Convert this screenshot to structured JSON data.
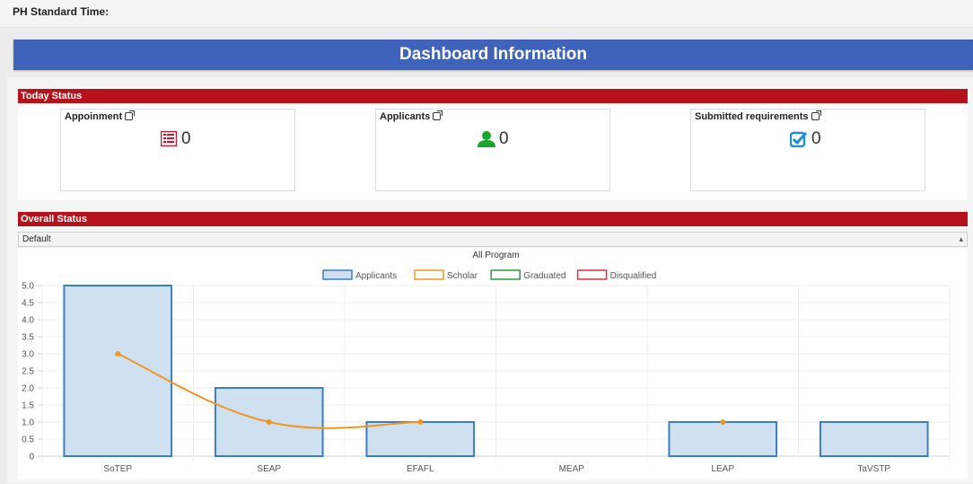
{
  "header": {
    "ph_time_label": "PH Standard Time:"
  },
  "dashboard_title": "Dashboard Information",
  "today_status": {
    "title": "Today Status",
    "cards": [
      {
        "label": "Appoinment",
        "value": "0",
        "icon": "list-icon",
        "color": "#d0112b"
      },
      {
        "label": "Applicants",
        "value": "0",
        "icon": "user-icon",
        "color": "#16a52c"
      },
      {
        "label": "Submitted requirements",
        "value": "0",
        "icon": "check-square-icon",
        "color": "#1a8fd6"
      }
    ]
  },
  "overall_status": {
    "title": "Overall Status",
    "filter": {
      "selected": "Default"
    }
  },
  "colors": {
    "header_blue": "#3f63ba",
    "section_red": "#b5121b"
  },
  "chart_data": {
    "type": "bar",
    "title": "All Program",
    "categories": [
      "SoTEP",
      "SEAP",
      "EFAFL",
      "MEAP",
      "LEAP",
      "TaVSTP"
    ],
    "ylim": [
      0,
      5
    ],
    "yticks": [
      "0",
      "0.5",
      "1.0",
      "1.5",
      "2.0",
      "2.5",
      "3.0",
      "3.5",
      "4.0",
      "4.5",
      "5.0"
    ],
    "legend_position": "top",
    "series": [
      {
        "name": "Applicants",
        "kind": "bar",
        "color": "#3a7fc4",
        "fill": "#cfe1f0",
        "values": [
          5,
          2,
          1,
          0,
          1,
          1
        ]
      },
      {
        "name": "Scholar",
        "kind": "line",
        "color": "#f0961d",
        "values": [
          3,
          1,
          1,
          null,
          1,
          null
        ]
      },
      {
        "name": "Graduated",
        "kind": "line",
        "color": "#2e9a3a",
        "values": []
      },
      {
        "name": "Disqualified",
        "kind": "line",
        "color": "#e0303a",
        "values": []
      }
    ]
  }
}
